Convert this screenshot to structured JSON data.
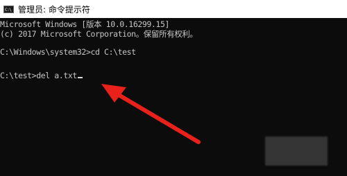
{
  "window": {
    "title": "管理员: 命令提示符",
    "icon": "cmd-icon",
    "icon_text": "C:\\"
  },
  "console": {
    "lines": [
      "Microsoft Windows [版本 10.0.16299.15]",
      "(c) 2017 Microsoft Corporation。保留所有权利。",
      "C:\\Windows\\system32>cd C:\\test",
      "C:\\test>del a.txt"
    ]
  },
  "annotation": {
    "arrow_color": "#e8211a"
  }
}
